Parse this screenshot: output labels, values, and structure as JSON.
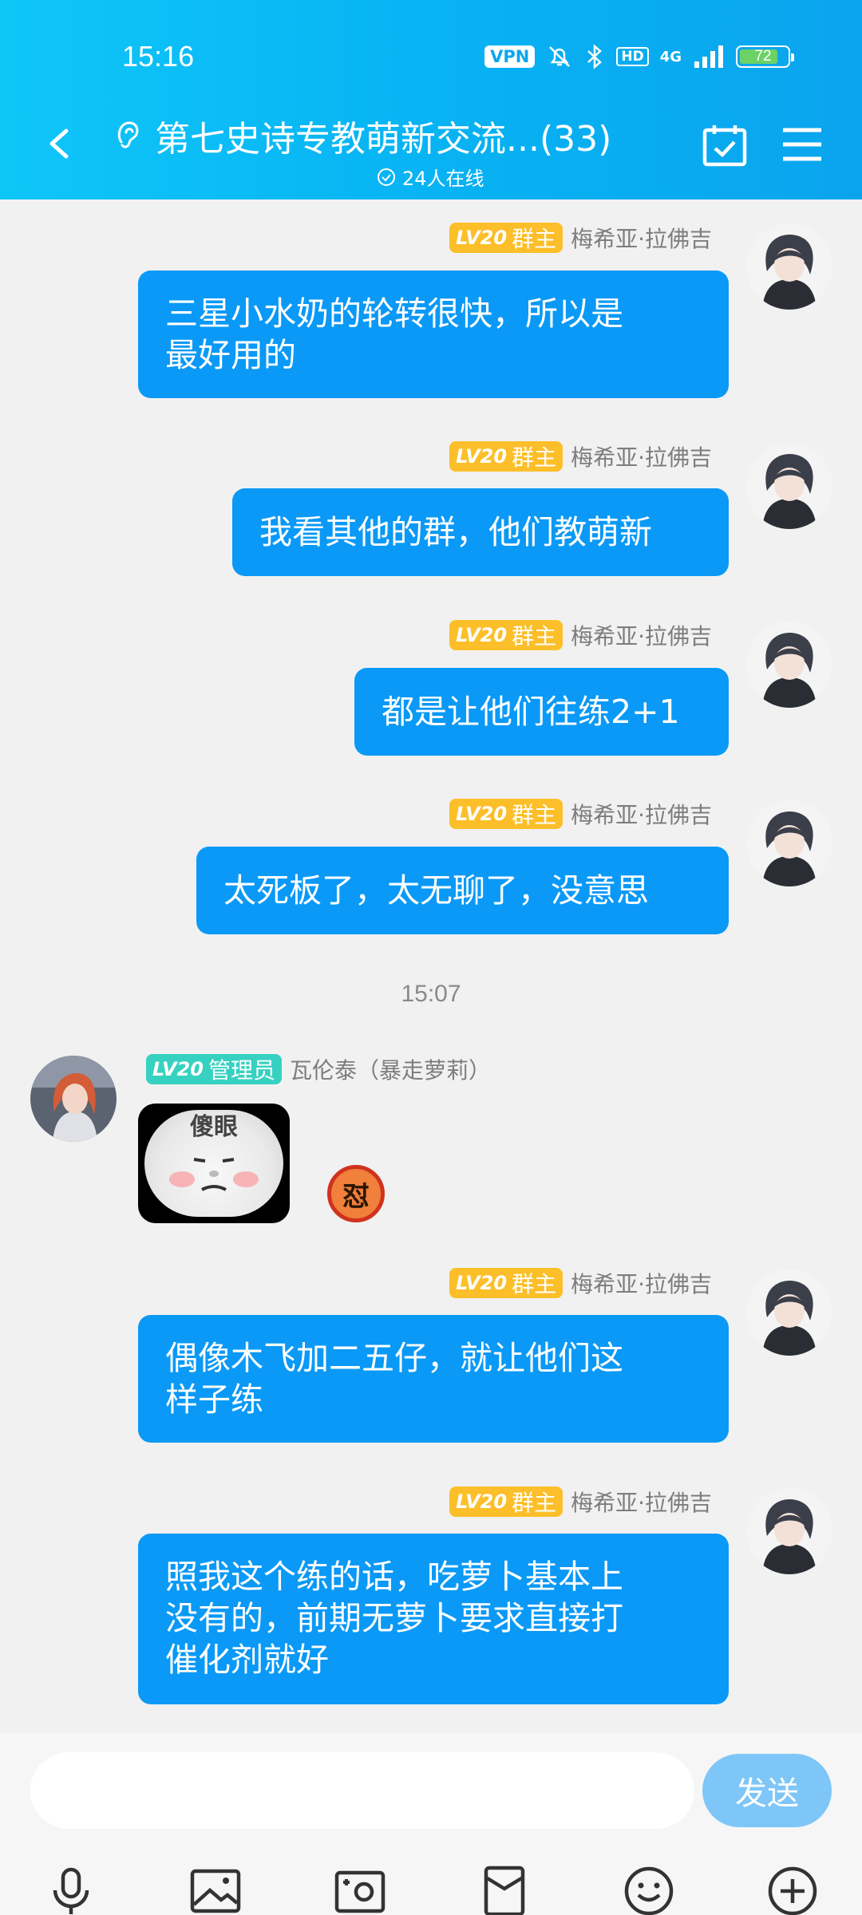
{
  "status_bar": {
    "time": "15:16",
    "vpn": "VPN",
    "hd": "HD",
    "network": "4G",
    "battery": "72"
  },
  "header": {
    "title": "第七史诗专教萌新交流...(33)",
    "online": "24人在线"
  },
  "badges": {
    "level": "LV20",
    "owner": "群主",
    "admin": "管理员"
  },
  "messages": [
    {
      "sender": "梅希亚·拉佛吉",
      "text_lines": [
        "三星小水奶的轮转很快，所以是",
        "最好用的"
      ]
    },
    {
      "sender": "梅希亚·拉佛吉",
      "text_lines": [
        "我看其他的群，他们教萌新"
      ]
    },
    {
      "sender": "梅希亚·拉佛吉",
      "text_lines": [
        "都是让他们往练2+1"
      ]
    },
    {
      "sender": "梅希亚·拉佛吉",
      "text_lines": [
        "太死板了，太无聊了，没意思"
      ]
    },
    {
      "sender": "瓦伦泰（暴走萝莉）",
      "sticker_caption": "傻眼",
      "emoji_text": "怼"
    },
    {
      "sender": "梅希亚·拉佛吉",
      "text_lines": [
        "偶像木飞加二五仔，就让他们这",
        "样子练"
      ]
    },
    {
      "sender": "梅希亚·拉佛吉",
      "text_lines": [
        "照我这个练的话，吃萝卜基本上",
        "没有的，前期无萝卜要求直接打",
        "催化剂就好"
      ]
    }
  ],
  "timestamp": "15:07",
  "input_bar": {
    "placeholder": "",
    "send_label": "发送"
  },
  "colors": {
    "header": "#08b3f3",
    "bubble": "#0a99f6",
    "owner_badge": "#fcbf29",
    "admin_badge": "#36d1c0",
    "send_button": "#7ec6f7"
  },
  "toolbar_icons": [
    "microphone-icon",
    "image-icon",
    "camera-icon",
    "red-packet-icon",
    "emoji-icon",
    "plus-icon"
  ]
}
